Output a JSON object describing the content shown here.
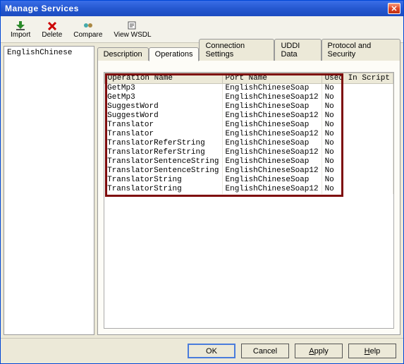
{
  "window": {
    "title": "Manage Services"
  },
  "toolbar": {
    "import": "Import",
    "delete": "Delete",
    "compare": "Compare",
    "view_wsdl": "View WSDL"
  },
  "sidebar": {
    "items": [
      "EnglishChinese"
    ]
  },
  "tabs": {
    "description": "Description",
    "operations": "Operations",
    "connection": "Connection Settings",
    "uddi": "UDDI Data",
    "protocol": "Protocol and Security"
  },
  "table": {
    "headers": {
      "operation": "Operation Name",
      "port": "Port Name",
      "used": "Used In Script"
    },
    "rows": [
      {
        "op": "GetMp3",
        "port": "EnglishChineseSoap",
        "used": "No"
      },
      {
        "op": "GetMp3",
        "port": "EnglishChineseSoap12",
        "used": "No"
      },
      {
        "op": "SuggestWord",
        "port": "EnglishChineseSoap",
        "used": "No"
      },
      {
        "op": "SuggestWord",
        "port": "EnglishChineseSoap12",
        "used": "No"
      },
      {
        "op": "Translator",
        "port": "EnglishChineseSoap",
        "used": "No"
      },
      {
        "op": "Translator",
        "port": "EnglishChineseSoap12",
        "used": "No"
      },
      {
        "op": "TranslatorReferString",
        "port": "EnglishChineseSoap",
        "used": "No"
      },
      {
        "op": "TranslatorReferString",
        "port": "EnglishChineseSoap12",
        "used": "No"
      },
      {
        "op": "TranslatorSentenceString",
        "port": "EnglishChineseSoap",
        "used": "No"
      },
      {
        "op": "TranslatorSentenceString",
        "port": "EnglishChineseSoap12",
        "used": "No"
      },
      {
        "op": "TranslatorString",
        "port": "EnglishChineseSoap",
        "used": "No"
      },
      {
        "op": "TranslatorString",
        "port": "EnglishChineseSoap12",
        "used": "No"
      }
    ]
  },
  "buttons": {
    "ok": "OK",
    "cancel": "Cancel",
    "apply": "Apply",
    "help": "Help"
  }
}
